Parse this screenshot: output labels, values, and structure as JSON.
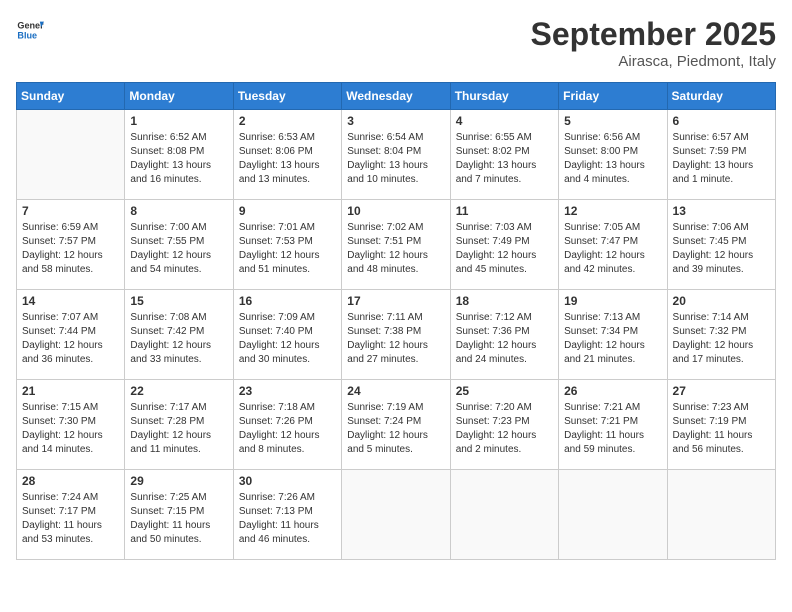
{
  "header": {
    "logo_line1": "General",
    "logo_line2": "Blue",
    "month": "September 2025",
    "location": "Airasca, Piedmont, Italy"
  },
  "weekdays": [
    "Sunday",
    "Monday",
    "Tuesday",
    "Wednesday",
    "Thursday",
    "Friday",
    "Saturday"
  ],
  "weeks": [
    [
      {
        "day": "",
        "info": ""
      },
      {
        "day": "1",
        "info": "Sunrise: 6:52 AM\nSunset: 8:08 PM\nDaylight: 13 hours\nand 16 minutes."
      },
      {
        "day": "2",
        "info": "Sunrise: 6:53 AM\nSunset: 8:06 PM\nDaylight: 13 hours\nand 13 minutes."
      },
      {
        "day": "3",
        "info": "Sunrise: 6:54 AM\nSunset: 8:04 PM\nDaylight: 13 hours\nand 10 minutes."
      },
      {
        "day": "4",
        "info": "Sunrise: 6:55 AM\nSunset: 8:02 PM\nDaylight: 13 hours\nand 7 minutes."
      },
      {
        "day": "5",
        "info": "Sunrise: 6:56 AM\nSunset: 8:00 PM\nDaylight: 13 hours\nand 4 minutes."
      },
      {
        "day": "6",
        "info": "Sunrise: 6:57 AM\nSunset: 7:59 PM\nDaylight: 13 hours\nand 1 minute."
      }
    ],
    [
      {
        "day": "7",
        "info": "Sunrise: 6:59 AM\nSunset: 7:57 PM\nDaylight: 12 hours\nand 58 minutes."
      },
      {
        "day": "8",
        "info": "Sunrise: 7:00 AM\nSunset: 7:55 PM\nDaylight: 12 hours\nand 54 minutes."
      },
      {
        "day": "9",
        "info": "Sunrise: 7:01 AM\nSunset: 7:53 PM\nDaylight: 12 hours\nand 51 minutes."
      },
      {
        "day": "10",
        "info": "Sunrise: 7:02 AM\nSunset: 7:51 PM\nDaylight: 12 hours\nand 48 minutes."
      },
      {
        "day": "11",
        "info": "Sunrise: 7:03 AM\nSunset: 7:49 PM\nDaylight: 12 hours\nand 45 minutes."
      },
      {
        "day": "12",
        "info": "Sunrise: 7:05 AM\nSunset: 7:47 PM\nDaylight: 12 hours\nand 42 minutes."
      },
      {
        "day": "13",
        "info": "Sunrise: 7:06 AM\nSunset: 7:45 PM\nDaylight: 12 hours\nand 39 minutes."
      }
    ],
    [
      {
        "day": "14",
        "info": "Sunrise: 7:07 AM\nSunset: 7:44 PM\nDaylight: 12 hours\nand 36 minutes."
      },
      {
        "day": "15",
        "info": "Sunrise: 7:08 AM\nSunset: 7:42 PM\nDaylight: 12 hours\nand 33 minutes."
      },
      {
        "day": "16",
        "info": "Sunrise: 7:09 AM\nSunset: 7:40 PM\nDaylight: 12 hours\nand 30 minutes."
      },
      {
        "day": "17",
        "info": "Sunrise: 7:11 AM\nSunset: 7:38 PM\nDaylight: 12 hours\nand 27 minutes."
      },
      {
        "day": "18",
        "info": "Sunrise: 7:12 AM\nSunset: 7:36 PM\nDaylight: 12 hours\nand 24 minutes."
      },
      {
        "day": "19",
        "info": "Sunrise: 7:13 AM\nSunset: 7:34 PM\nDaylight: 12 hours\nand 21 minutes."
      },
      {
        "day": "20",
        "info": "Sunrise: 7:14 AM\nSunset: 7:32 PM\nDaylight: 12 hours\nand 17 minutes."
      }
    ],
    [
      {
        "day": "21",
        "info": "Sunrise: 7:15 AM\nSunset: 7:30 PM\nDaylight: 12 hours\nand 14 minutes."
      },
      {
        "day": "22",
        "info": "Sunrise: 7:17 AM\nSunset: 7:28 PM\nDaylight: 12 hours\nand 11 minutes."
      },
      {
        "day": "23",
        "info": "Sunrise: 7:18 AM\nSunset: 7:26 PM\nDaylight: 12 hours\nand 8 minutes."
      },
      {
        "day": "24",
        "info": "Sunrise: 7:19 AM\nSunset: 7:24 PM\nDaylight: 12 hours\nand 5 minutes."
      },
      {
        "day": "25",
        "info": "Sunrise: 7:20 AM\nSunset: 7:23 PM\nDaylight: 12 hours\nand 2 minutes."
      },
      {
        "day": "26",
        "info": "Sunrise: 7:21 AM\nSunset: 7:21 PM\nDaylight: 11 hours\nand 59 minutes."
      },
      {
        "day": "27",
        "info": "Sunrise: 7:23 AM\nSunset: 7:19 PM\nDaylight: 11 hours\nand 56 minutes."
      }
    ],
    [
      {
        "day": "28",
        "info": "Sunrise: 7:24 AM\nSunset: 7:17 PM\nDaylight: 11 hours\nand 53 minutes."
      },
      {
        "day": "29",
        "info": "Sunrise: 7:25 AM\nSunset: 7:15 PM\nDaylight: 11 hours\nand 50 minutes."
      },
      {
        "day": "30",
        "info": "Sunrise: 7:26 AM\nSunset: 7:13 PM\nDaylight: 11 hours\nand 46 minutes."
      },
      {
        "day": "",
        "info": ""
      },
      {
        "day": "",
        "info": ""
      },
      {
        "day": "",
        "info": ""
      },
      {
        "day": "",
        "info": ""
      }
    ]
  ]
}
